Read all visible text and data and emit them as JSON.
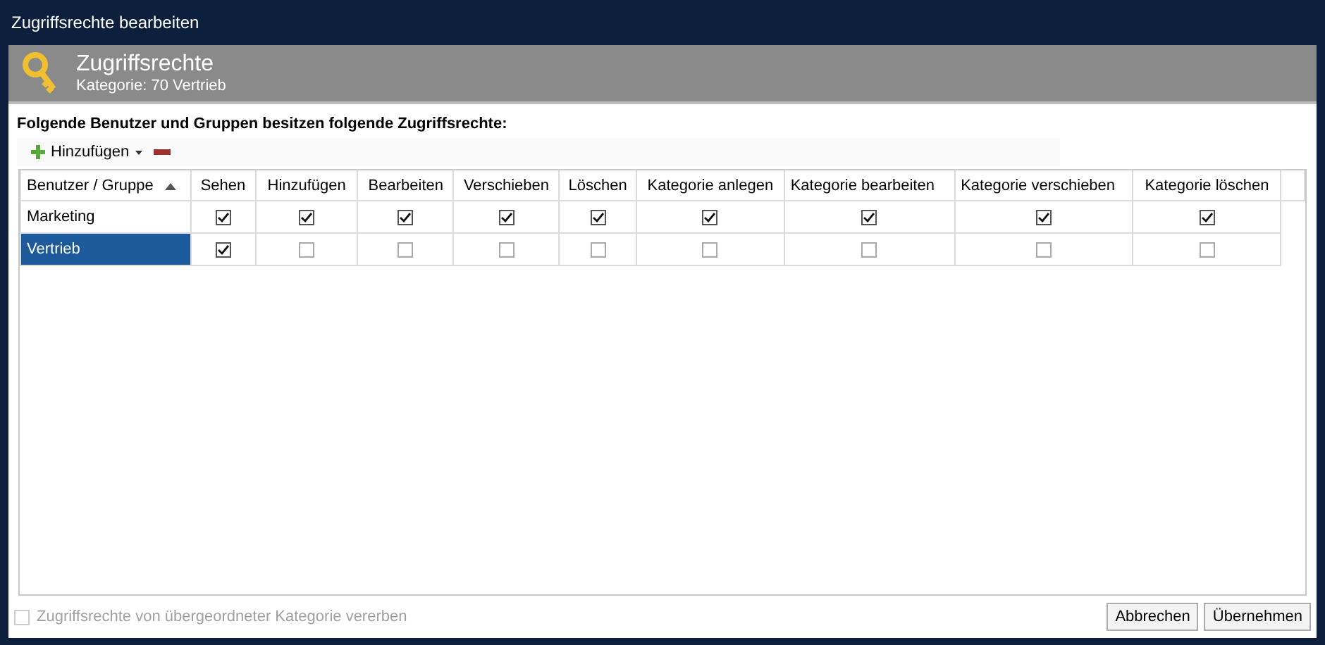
{
  "window": {
    "title": "Zugriffsrechte bearbeiten"
  },
  "header": {
    "title": "Zugriffsrechte",
    "subtitle": "Kategorie: 70 Vertrieb"
  },
  "intro": "Folgende Benutzer und Gruppen besitzen folgende Zugriffsrechte:",
  "toolbar": {
    "add_label": "Hinzufügen"
  },
  "table": {
    "columns": [
      "Benutzer / Gruppe",
      "Sehen",
      "Hinzufügen",
      "Bearbeiten",
      "Verschieben",
      "Löschen",
      "Kategorie anlegen",
      "Kategorie bearbeiten",
      "Kategorie verschieben",
      "Kategorie löschen"
    ],
    "rows": [
      {
        "name": "Marketing",
        "selected": false,
        "rights": [
          true,
          true,
          true,
          true,
          true,
          true,
          true,
          true,
          true
        ]
      },
      {
        "name": "Vertrieb",
        "selected": true,
        "rights": [
          true,
          false,
          false,
          false,
          false,
          false,
          false,
          false,
          false
        ]
      }
    ]
  },
  "inherit": {
    "label": "Zugriffsrechte von übergeordneter Kategorie vererben",
    "checked": false,
    "disabled": true
  },
  "buttons": [
    "Abbrechen",
    "Übernehmen"
  ]
}
